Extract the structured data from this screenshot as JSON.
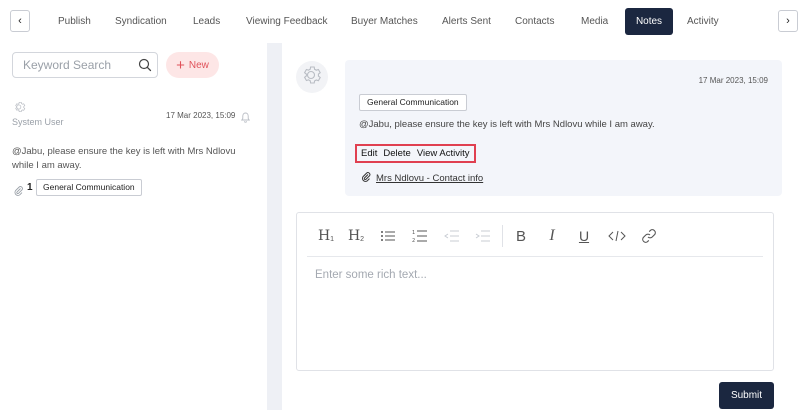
{
  "tabs": {
    "items": [
      {
        "label": "Publish"
      },
      {
        "label": "Syndication"
      },
      {
        "label": "Leads"
      },
      {
        "label": "Viewing Feedback"
      },
      {
        "label": "Buyer Matches"
      },
      {
        "label": "Alerts Sent"
      },
      {
        "label": "Contacts"
      },
      {
        "label": "Media"
      },
      {
        "label": "Notes",
        "active": true
      },
      {
        "label": "Activity"
      }
    ],
    "prev_arrow": "‹",
    "next_arrow": "›"
  },
  "sidebar": {
    "search_placeholder": "Keyword Search",
    "search_value": "",
    "new_button_icon": "+",
    "new_button_label": "New",
    "note": {
      "author": "System User",
      "date": "17 Mar 2023, 15:09",
      "text": "@Jabu, please ensure the key is left with Mrs Ndlovu while I am away.",
      "attachment_count": "1",
      "tag": "General Communication"
    }
  },
  "detail": {
    "date": "17 Mar 2023, 15:09",
    "tag": "General Communication",
    "text": "@Jabu, please ensure the key is left with Mrs Ndlovu while I am away.",
    "actions": {
      "edit": "Edit",
      "delete": "Delete",
      "view_activity": "View Activity"
    },
    "contact_link": "Mrs Ndlovu - Contact info"
  },
  "editor": {
    "toolbar": {
      "h1": "H",
      "h1_sub": "1",
      "h2": "H",
      "h2_sub": "2",
      "bold": "B",
      "italic": "I",
      "underline": "U"
    },
    "placeholder": "Enter some rich text..."
  },
  "submit_label": "Submit",
  "colors": {
    "primary_dark": "#1b2740",
    "new_button_bg": "#fde6e6",
    "new_button_text": "#e0525a",
    "highlight_border": "#e04050",
    "panel_bg": "#eef0f5"
  }
}
